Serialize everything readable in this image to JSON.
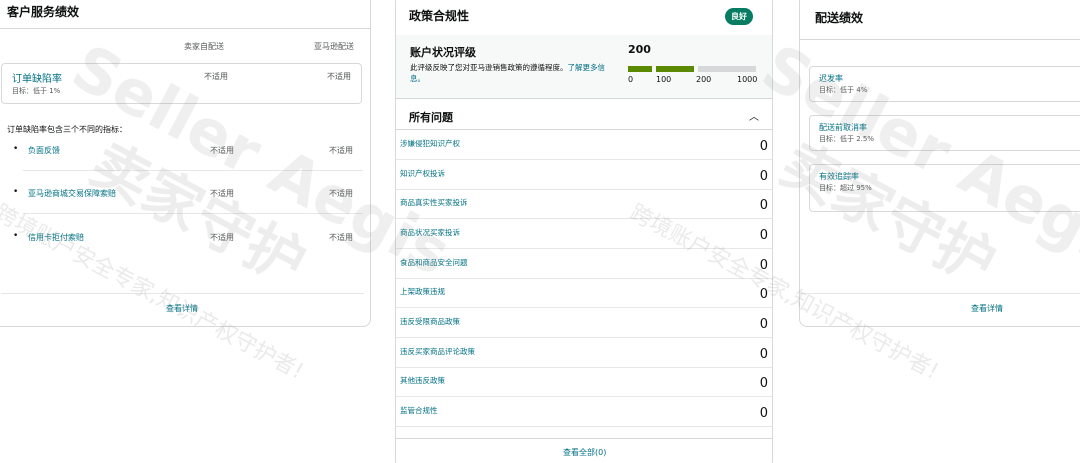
{
  "customer_service": {
    "title": "客户服务绩效",
    "columns": [
      "卖家自配送",
      "亚马逊配送"
    ],
    "odr": {
      "label": "订单缺陷率",
      "target": "目标：低于 1%",
      "values": [
        "不适用",
        "不适用"
      ]
    },
    "description": "订单缺陷率包含三个不同的指标：",
    "metrics": [
      {
        "name": "负面反馈",
        "values": [
          "不适用",
          "不适用"
        ]
      },
      {
        "name": "亚马逊商城交易保障索赔",
        "values": [
          "不适用",
          "不适用"
        ]
      },
      {
        "name": "信用卡拒付索赔",
        "values": [
          "不适用",
          "不适用"
        ]
      }
    ],
    "details_link": "查看详情"
  },
  "policy_compliance": {
    "title": "政策合规性",
    "badge": "良好",
    "ahr": {
      "title": "账户状况评级",
      "description": "此评级反映了您对亚马逊销售政策的遵循程度。",
      "learn_more": "了解更多信息。",
      "score": "200",
      "score_value": 200,
      "ticks": [
        "0",
        "100",
        "200",
        "1000"
      ]
    },
    "issues_title": "所有问题",
    "issues": [
      {
        "name": "涉嫌侵犯知识产权",
        "count": "0"
      },
      {
        "name": "知识产权投诉",
        "count": "0"
      },
      {
        "name": "商品真实性买家投诉",
        "count": "0"
      },
      {
        "name": "商品状况买家投诉",
        "count": "0"
      },
      {
        "name": "食品和商品安全问题",
        "count": "0"
      },
      {
        "name": "上架政策违规",
        "count": "0"
      },
      {
        "name": "违反受限商品政策",
        "count": "0"
      },
      {
        "name": "违反买家商品评论政策",
        "count": "0"
      },
      {
        "name": "其他违反政策",
        "count": "0"
      },
      {
        "name": "监管合规性",
        "count": "0"
      }
    ],
    "view_all": "查看全部(0)"
  },
  "shipping_performance": {
    "title": "配送绩效",
    "metrics": [
      {
        "name": "迟发率",
        "target": "目标：低于 4%"
      },
      {
        "name": "配送前取消率",
        "target": "目标：低于 2.5%"
      },
      {
        "name": "有效追踪率",
        "target": "目标：超过 95%"
      }
    ],
    "details_link": "查看详情"
  },
  "watermark": {
    "brand": "Seller Aegis",
    "cn": "卖家守护",
    "slogan": "跨境账户安全专家,知识产权守护者!"
  },
  "colors": {
    "link": "#007185",
    "badge_good": "#067d62",
    "bar_filled": "#5b8a00",
    "bar_empty": "#d5d9d9"
  }
}
